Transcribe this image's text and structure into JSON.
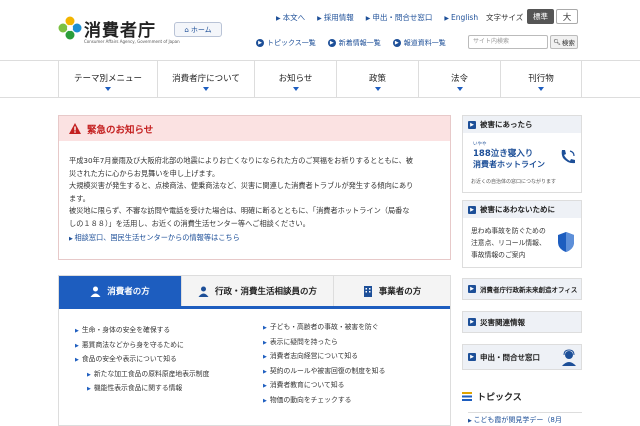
{
  "header": {
    "logo_text": "消費者庁",
    "logo_sub": "Consumer Affairs Agency, Government of Japan",
    "home": "ホーム",
    "top_links": [
      "本文へ",
      "採用情報",
      "申出・問合せ窓口",
      "English"
    ],
    "font_size_label": "文字サイズ",
    "font_std": "標準",
    "font_large": "大",
    "sub_links": [
      "トピックス一覧",
      "新着情報一覧",
      "報道資料一覧"
    ],
    "search_placeholder": "サイト内検索",
    "search_button": "検索"
  },
  "nav": [
    "テーマ別メニュー",
    "消費者庁について",
    "お知らせ",
    "政策",
    "法令",
    "刊行物"
  ],
  "emergency": {
    "title": "緊急のお知らせ",
    "lines": [
      "平成30年7月豪雨及び大阪府北部の地震によりお亡くなりになられた方のご冥福をお祈りするとともに、被",
      "災された方に心からお見舞いを申し上げます。",
      "大規模災害が発生すると、点検商法、便乗商法など、災害に関連した消費者トラブルが発生する傾向にあり",
      "ます。",
      "被災地に限らず、不審な訪問や電話を受けた場合は、明確に断るとともに、「消費者ホットライン（局番な",
      "しの１８８）」を活用し、お近くの消費生活センター等へご相談ください。"
    ],
    "link": "相談窓口、国民生活センターからの情報等はこちら"
  },
  "tabs": [
    "消費者の方",
    "行政・消費生活相談員の方",
    "事業者の方"
  ],
  "tab_list_left": [
    {
      "text": "生命・身体の安全を確保する",
      "sub": false
    },
    {
      "text": "悪質商法などから身を守るために",
      "sub": false
    },
    {
      "text": "食品の安全や表示について知る",
      "sub": false
    },
    {
      "text": "新たな加工食品の原料原産地表示制度",
      "sub": true
    },
    {
      "text": "機能性表示食品に関する情報",
      "sub": true
    }
  ],
  "tab_list_right": [
    "子ども・高齢者の事故・被害を防ぐ",
    "表示に疑問を持ったら",
    "消費者志向経営について知る",
    "契約のルールや被害回復の制度を知る",
    "消費者教育について知る",
    "物価の動向をチェックする"
  ],
  "sidebar": {
    "damage_title": "被害にあったら",
    "hotline_kana": "いやや",
    "hotline_main": "188泣き寝入り",
    "hotline_name": "消費者ホットライン",
    "hotline_note": "お近くの自治体の窓口につながります",
    "prevent_title": "被害にあわないために",
    "prevent_lines": [
      "思わぬ事故を防ぐための",
      "注意点、リコール情報、",
      "事故情報のご案内"
    ],
    "office": "消費者庁行政新未来創造オフィス",
    "disaster": "災害関連情報",
    "contact": "申出・問合せ窓口",
    "topics_title": "トピックス",
    "topics_first": "こども霞が関見学デー（8月"
  },
  "colors": {
    "accent": "#1d5dbf",
    "link": "#1d4f98",
    "alert": "#c42020",
    "alert_bg": "#fbe2e2"
  }
}
